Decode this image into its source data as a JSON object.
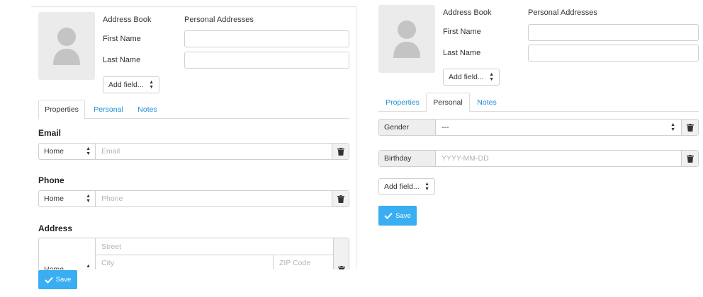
{
  "left": {
    "address_book_label": "Address Book",
    "address_book_value": "Personal Addresses",
    "first_name_label": "First Name",
    "last_name_label": "Last Name",
    "add_field_label": "Add field...",
    "tabs": [
      {
        "label": "Properties",
        "active": true
      },
      {
        "label": "Personal",
        "active": false
      },
      {
        "label": "Notes",
        "active": false
      }
    ],
    "email": {
      "heading": "Email",
      "type": "Home",
      "placeholder": "Email"
    },
    "phone": {
      "heading": "Phone",
      "type": "Home",
      "placeholder": "Phone"
    },
    "address": {
      "heading": "Address",
      "type": "Home",
      "street_placeholder": "Street",
      "city_placeholder": "City",
      "zip_placeholder": "ZIP Code"
    },
    "save_label": "Save"
  },
  "right": {
    "address_book_label": "Address Book",
    "address_book_value": "Personal Addresses",
    "first_name_label": "First Name",
    "last_name_label": "Last Name",
    "add_field_label": "Add field...",
    "tabs": [
      {
        "label": "Properties",
        "active": false
      },
      {
        "label": "Personal",
        "active": true
      },
      {
        "label": "Notes",
        "active": false
      }
    ],
    "gender": {
      "label": "Gender",
      "value": "---"
    },
    "birthday": {
      "label": "Birthday",
      "placeholder": "YYYY-MM-DD"
    },
    "add_field_bottom_label": "Add field...",
    "save_label": "Save"
  },
  "colors": {
    "accent": "#3aaef2",
    "link": "#1b8fd6",
    "avatar_bg": "#ebebeb",
    "avatar_fg": "#c4c4c4"
  },
  "icons": [
    "user-avatar-icon",
    "trash-icon",
    "check-icon",
    "caret-updown-icon"
  ]
}
